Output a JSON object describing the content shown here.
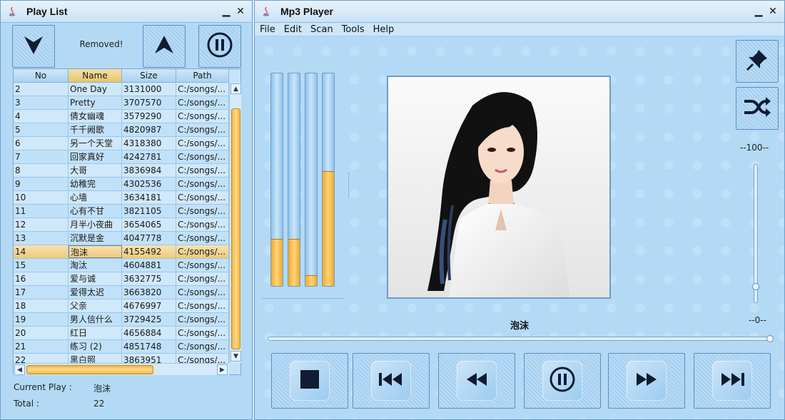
{
  "playlist_window": {
    "title": "Play List",
    "status_message": "Removed!",
    "columns": [
      "No",
      "Name",
      "Size",
      "Path"
    ],
    "sorted_column": "Name",
    "rows": [
      {
        "no": "2",
        "name": "One Day",
        "size": "3131000",
        "path": "C:/songs/..."
      },
      {
        "no": "3",
        "name": "Pretty",
        "size": "3707570",
        "path": "C:/songs/..."
      },
      {
        "no": "4",
        "name": "倩女幽魂",
        "size": "3579290",
        "path": "C:/songs/..."
      },
      {
        "no": "5",
        "name": "千千阙歌",
        "size": "4820987",
        "path": "C:/songs/..."
      },
      {
        "no": "6",
        "name": "另一个天堂",
        "size": "4318380",
        "path": "C:/songs/..."
      },
      {
        "no": "7",
        "name": "回家真好",
        "size": "4242781",
        "path": "C:/songs/..."
      },
      {
        "no": "8",
        "name": "大哥",
        "size": "3836984",
        "path": "C:/songs/..."
      },
      {
        "no": "9",
        "name": "幼稚完",
        "size": "4302536",
        "path": "C:/songs/..."
      },
      {
        "no": "10",
        "name": "心墙",
        "size": "3634181",
        "path": "C:/songs/..."
      },
      {
        "no": "11",
        "name": "心有不甘",
        "size": "3821105",
        "path": "C:/songs/..."
      },
      {
        "no": "12",
        "name": "月半小夜曲",
        "size": "3654065",
        "path": "C:/songs/..."
      },
      {
        "no": "13",
        "name": "沉默是金",
        "size": "4047778",
        "path": "C:/songs/..."
      },
      {
        "no": "14",
        "name": "泡沫",
        "size": "4155492",
        "path": "C:/songs/..."
      },
      {
        "no": "15",
        "name": "淘汰",
        "size": "4604881",
        "path": "C:/songs/..."
      },
      {
        "no": "16",
        "name": "爱与诚",
        "size": "3632775",
        "path": "C:/songs/..."
      },
      {
        "no": "17",
        "name": "爱得太迟",
        "size": "3663820",
        "path": "C:/songs/..."
      },
      {
        "no": "18",
        "name": "父亲",
        "size": "4676997",
        "path": "C:/songs/..."
      },
      {
        "no": "19",
        "name": "男人信什么",
        "size": "3729425",
        "path": "C:/songs/..."
      },
      {
        "no": "20",
        "name": "红日",
        "size": "4656884",
        "path": "C:/songs/..."
      },
      {
        "no": "21",
        "name": "练习 (2)",
        "size": "4851748",
        "path": "C:/songs/..."
      },
      {
        "no": "22",
        "name": "黑白照",
        "size": "3863951",
        "path": "C:/songs/..."
      }
    ],
    "selected_row_no": "14",
    "current_play_label": "Current Play :",
    "current_play_value": "泡沫",
    "total_label": "Total :",
    "total_value": "22"
  },
  "player_window": {
    "title": "Mp3 Player",
    "menu": [
      "File",
      "Edit",
      "Scan",
      "Tools",
      "Help"
    ],
    "equalizer_levels": [
      0.22,
      0.22,
      0.05,
      0.54
    ],
    "now_playing": "泡沫",
    "volume_max_label": "--100--",
    "volume_min_label": "--0--",
    "volume_level": 0.1,
    "progress": 1.0
  },
  "colors": {
    "accent": "#f0b64a",
    "background": "#b3d9f5",
    "selection": "#efc97a"
  },
  "icons": {
    "playlist_buttons": [
      "move-down-icon",
      "move-up-icon",
      "pause-icon"
    ],
    "side_buttons": [
      "pin-icon",
      "shuffle-icon"
    ],
    "controls": [
      "stop-icon",
      "skip-first-icon",
      "rewind-icon",
      "pause-icon",
      "fast-forward-icon",
      "skip-last-icon"
    ]
  }
}
